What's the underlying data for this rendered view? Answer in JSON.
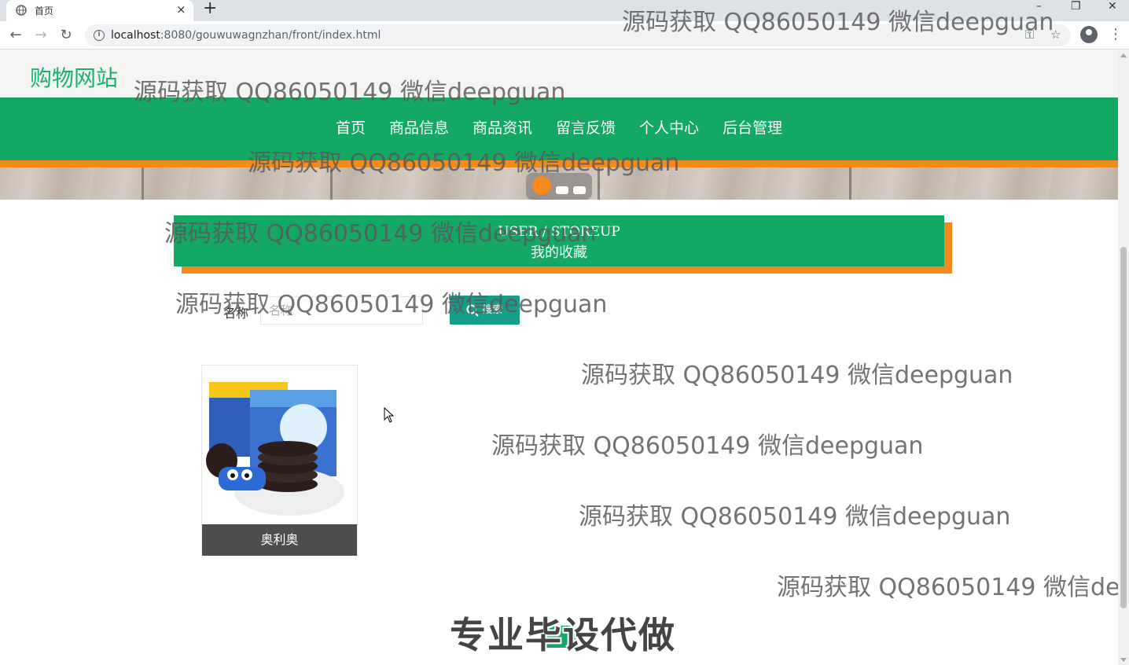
{
  "browser": {
    "tab_title": "首页",
    "tab_close": "×",
    "new_tab": "+",
    "url_host": "localhost",
    "url_path": ":8080/gouwuwagnzhan/front/index.html",
    "window_controls": [
      "–",
      "❐",
      "✕"
    ]
  },
  "site": {
    "logo": "购物网站",
    "nav": [
      "首页",
      "商品信息",
      "商品资讯",
      "留言反馈",
      "个人中心",
      "后台管理"
    ]
  },
  "section": {
    "title_en": "USER / STOREUP",
    "title_cn": "我的收藏"
  },
  "search": {
    "label": "名称",
    "placeholder": "名称",
    "button": "搜索"
  },
  "products": [
    {
      "name": "奥利奥"
    }
  ],
  "watermark": "源码获取 QQ86050149 微信deepguan",
  "promo": "专业毕设代做",
  "colors": {
    "primary": "#14a865",
    "accent": "#f48a1c",
    "search_button": "#159e89",
    "caption_bg": "#4d4d4d"
  }
}
